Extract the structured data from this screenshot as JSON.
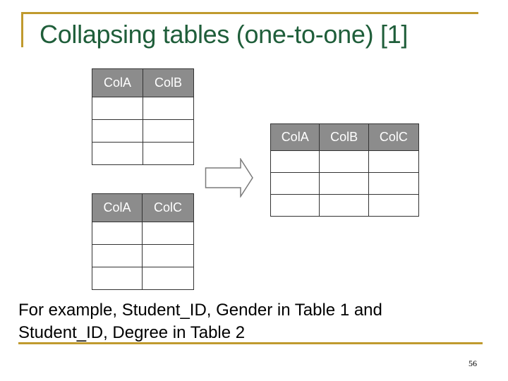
{
  "slide": {
    "title": "Collapsing tables (one-to-one) [1]",
    "accent_color": "#c09a2e",
    "title_color": "#1f5e3a",
    "table1": {
      "headers": [
        "ColA",
        "ColB"
      ],
      "rows": [
        [
          "",
          ""
        ],
        [
          "",
          ""
        ],
        [
          "",
          ""
        ]
      ]
    },
    "table2": {
      "headers": [
        "ColA",
        "ColC"
      ],
      "rows": [
        [
          "",
          ""
        ],
        [
          "",
          ""
        ],
        [
          "",
          ""
        ]
      ]
    },
    "result_table": {
      "headers": [
        "ColA",
        "ColB",
        "ColC"
      ],
      "rows": [
        [
          "",
          "",
          ""
        ],
        [
          "",
          "",
          ""
        ],
        [
          "",
          "",
          ""
        ]
      ]
    },
    "arrow_icon": "right-arrow-icon",
    "caption_line1": "For example, Student_ID, Gender in Table 1 and",
    "caption_line2": "Student_ID, Degree in Table 2",
    "page_number": "56"
  }
}
